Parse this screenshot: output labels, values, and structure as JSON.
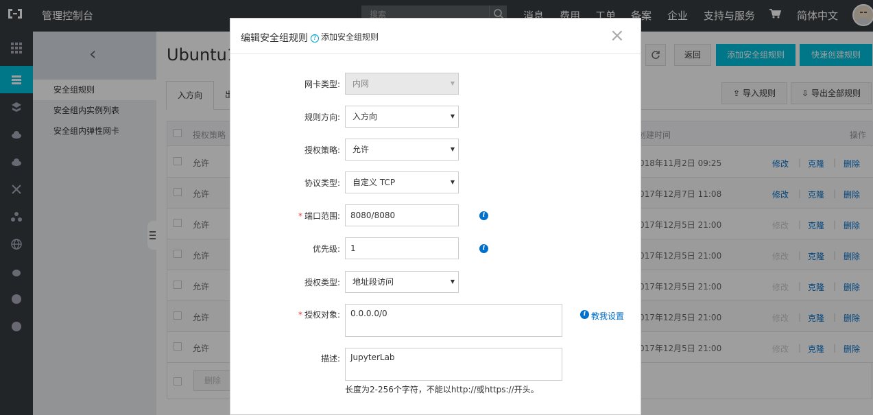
{
  "topbar": {
    "title": "管理控制台",
    "search_placeholder": "搜索",
    "nav": [
      "消息",
      "费用",
      "工单",
      "备案",
      "企业",
      "支持与服务",
      "简体中文"
    ],
    "icons": [
      "logo-icon",
      "search-icon",
      "cart-icon",
      "avatar"
    ]
  },
  "subnav": {
    "back_icon": "chevron-left-icon",
    "items": [
      {
        "label": "安全组规则"
      },
      {
        "label": "安全组内实例列表"
      },
      {
        "label": "安全组内弹性网卡"
      }
    ]
  },
  "main": {
    "title": "Ubuntu1",
    "buttons": {
      "refresh_icon": "refresh-icon",
      "back": "返回",
      "add_rule": "添加安全组规则",
      "quick_create": "快速创建规则",
      "import": "导入规则",
      "export": "导出全部规则"
    },
    "tabs": [
      "入方向",
      "出"
    ],
    "table": {
      "headers": {
        "policy": "授权策略",
        "created": "创建时间",
        "actions": "操作"
      },
      "rows": [
        {
          "policy": "允许",
          "created": "018年11月2日 09:25",
          "edit_enabled": true
        },
        {
          "policy": "允许",
          "created": "017年12月7日 11:08",
          "edit_enabled": true
        },
        {
          "policy": "允许",
          "created": "017年12月5日 21:00",
          "edit_enabled": false
        },
        {
          "policy": "允许",
          "created": "017年12月5日 21:00",
          "edit_enabled": false
        },
        {
          "policy": "允许",
          "created": "017年12月5日 21:00",
          "edit_enabled": false
        },
        {
          "policy": "允许",
          "created": "017年12月5日 21:00",
          "edit_enabled": false
        },
        {
          "policy": "允许",
          "created": "017年12月5日 21:00",
          "edit_enabled": false
        }
      ],
      "action_labels": {
        "edit": "修改",
        "clone": "克隆",
        "delete": "删除",
        "separator": "|"
      },
      "footer_delete": "删除"
    }
  },
  "dialog": {
    "title": "编辑安全组规则",
    "help": "添加安全组规则",
    "help_icon": "?",
    "close": "×",
    "fields": {
      "nic_type": {
        "label": "网卡类型:",
        "value": "内网"
      },
      "direction": {
        "label": "规则方向:",
        "value": "入方向"
      },
      "policy": {
        "label": "授权策略:",
        "value": "允许"
      },
      "protocol": {
        "label": "协议类型:",
        "value": "自定义 TCP"
      },
      "port_range": {
        "label": "端口范围:",
        "value": "8080/8080",
        "required": "*"
      },
      "priority": {
        "label": "优先级:",
        "value": "1"
      },
      "auth_type": {
        "label": "授权类型:",
        "value": "地址段访问"
      },
      "auth_object": {
        "label": "授权对象:",
        "value": "0.0.0.0/0",
        "required": "*"
      },
      "description": {
        "label": "描述:",
        "value": "JupyterLab"
      }
    },
    "teach_link": "教我设置",
    "info_glyph": "i",
    "hint": "长度为2-256个字符，不能以http://或https://开头。"
  },
  "colors": {
    "accent": "#00c1de",
    "link": "#0070cc",
    "topbar": "#373d41",
    "required": "#e4393c"
  }
}
